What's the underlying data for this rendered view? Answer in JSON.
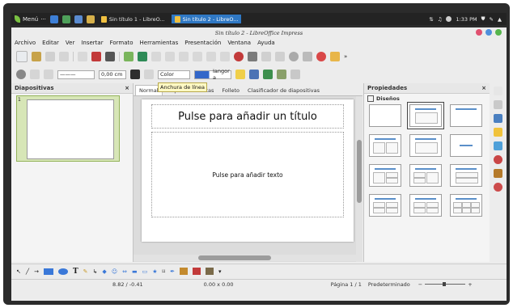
{
  "panel": {
    "menu_label": "Menú",
    "tasks": [
      {
        "label": "Sin título 1 - LibreO..."
      },
      {
        "label": "Sin título 2 - LibreO..."
      }
    ],
    "clock": "1:33 PM"
  },
  "window": {
    "title": "Sin título 2 - LibreOffice Impress"
  },
  "menubar": {
    "items": [
      "Archivo",
      "Editar",
      "Ver",
      "Insertar",
      "Formato",
      "Herramientas",
      "Presentación",
      "Ventana",
      "Ayuda"
    ]
  },
  "toolbar2": {
    "line_width": "0,00 cm",
    "color_label": "Color",
    "fill_label": "Iangor a"
  },
  "slides_pane": {
    "title": "Diapositivas",
    "close": "×",
    "slide_number": "1"
  },
  "center": {
    "tabs": [
      "Normal",
      "Esquema",
      "Notas",
      "Folleto",
      "Clasificador de diapositivas"
    ],
    "tooltip": "Anchura de línea",
    "title_placeholder": "Pulse para añadir un título",
    "body_placeholder": "Pulse para añadir texto"
  },
  "properties": {
    "title": "Propiedades",
    "close": "×",
    "section": "Diseños"
  },
  "statusbar": {
    "position": "8.82 / -0.41",
    "size": "0.00 x 0.00",
    "page": "Página 1 / 1",
    "master": "Predeterminado",
    "zoom_minus": "−",
    "zoom_plus": "+"
  },
  "colors": {
    "accent": "#2f78c4",
    "thumb_selected": "#d7e6b7",
    "layout_bar": "#5a8fc9"
  }
}
